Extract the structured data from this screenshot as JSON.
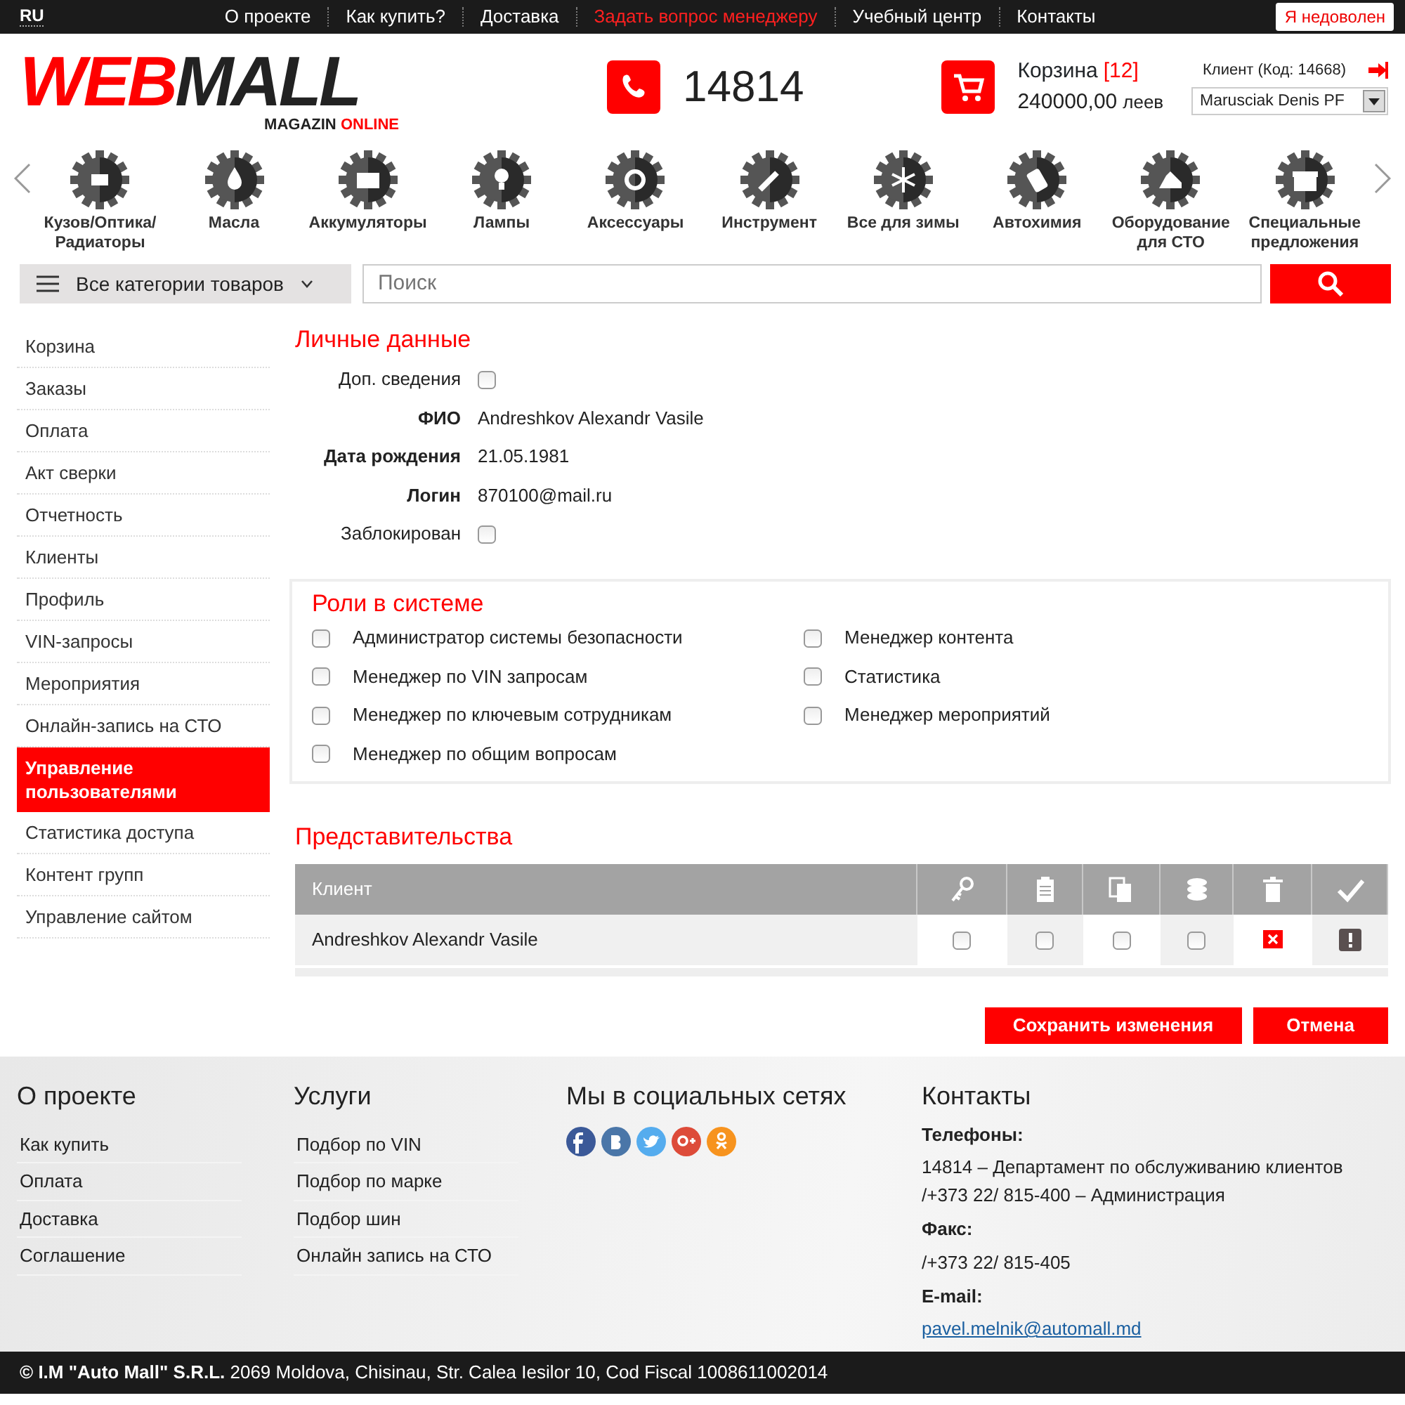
{
  "top_bar": {
    "language": "RU",
    "links": [
      {
        "label": "О проекте",
        "highlight": false
      },
      {
        "label": "Как купить?",
        "highlight": false
      },
      {
        "label": "Доставка",
        "highlight": false
      },
      {
        "label": "Задать вопрос менеджеру",
        "highlight": true
      },
      {
        "label": "Учебный центр",
        "highlight": false
      },
      {
        "label": "Контакты",
        "highlight": false
      }
    ],
    "complaint_button": "Я недоволен"
  },
  "header": {
    "logo": {
      "accent": "WEB",
      "rest": "MALL",
      "tagline": "MAGAZIN",
      "tagline_accent": "ONLINE"
    },
    "phone": "14814",
    "cart": {
      "label": "Корзина",
      "count": "[12]",
      "total": "240000,00",
      "currency": "леев"
    },
    "client": {
      "label": "Клиент (Код: 14668)",
      "account": "Marusciak Denis PF"
    }
  },
  "categories": [
    {
      "label": "Кузов/Оптика/ Радиаторы"
    },
    {
      "label": "Масла"
    },
    {
      "label": "Аккумуляторы"
    },
    {
      "label": "Лампы"
    },
    {
      "label": "Аксессуары"
    },
    {
      "label": "Инструмент"
    },
    {
      "label": "Все для зимы"
    },
    {
      "label": "Автохимия"
    },
    {
      "label": "Оборудование для СТО"
    },
    {
      "label": "Специальные предложения"
    }
  ],
  "search": {
    "categories_button": "Все категории товаров",
    "placeholder": "Поиск"
  },
  "sidebar": {
    "items": [
      {
        "label": "Корзина",
        "selected": false
      },
      {
        "label": "Заказы",
        "selected": false
      },
      {
        "label": "Оплата",
        "selected": false
      },
      {
        "label": "Акт сверки",
        "selected": false
      },
      {
        "label": "Отчетность",
        "selected": false
      },
      {
        "label": "Клиенты",
        "selected": false
      },
      {
        "label": "Профиль",
        "selected": false
      },
      {
        "label": "VIN-запросы",
        "selected": false
      },
      {
        "label": "Мероприятия",
        "selected": false
      },
      {
        "label": "Онлайн-запись на СТО",
        "selected": false
      },
      {
        "label": "Управление пользователями",
        "selected": true
      },
      {
        "label": "Статистика доступа",
        "selected": false
      },
      {
        "label": "Контент групп",
        "selected": false
      },
      {
        "label": "Управление сайтом",
        "selected": false
      }
    ]
  },
  "personal": {
    "title": "Личные данные",
    "fields": [
      {
        "kind": "checkbox",
        "label": "Доп. сведения",
        "checked": false
      },
      {
        "kind": "text",
        "label": "ФИО",
        "value": "Andreshkov Alexandr Vasile"
      },
      {
        "kind": "text",
        "label": "Дата рождения",
        "value": "21.05.1981"
      },
      {
        "kind": "text",
        "label": "Логин",
        "value": "870100@mail.ru"
      },
      {
        "kind": "checkbox",
        "label": "Заблокирован",
        "checked": false
      }
    ]
  },
  "roles": {
    "title": "Роли в системе",
    "columns": [
      [
        {
          "label": "Администратор системы безопасности",
          "checked": false
        },
        {
          "label": "Менеджер по VIN запросам",
          "checked": false
        },
        {
          "label": "Менеджер по ключевым сотрудникам",
          "checked": false
        },
        {
          "label": "Менеджер по общим вопросам",
          "checked": false
        }
      ],
      [
        {
          "label": "Менеджер контента",
          "checked": false
        },
        {
          "label": "Статистика",
          "checked": false
        },
        {
          "label": "Менеджер мероприятий",
          "checked": false
        }
      ]
    ]
  },
  "representations": {
    "title": "Представительства",
    "client_column": "Клиент",
    "rows": [
      {
        "client": "Andreshkov Alexandr Vasile",
        "cells": [
          {
            "kind": "checkbox",
            "checked": false
          },
          {
            "kind": "checkbox",
            "checked": false
          },
          {
            "kind": "checkbox",
            "checked": false
          },
          {
            "kind": "checkbox",
            "checked": false
          },
          {
            "kind": "delete"
          },
          {
            "kind": "warning"
          }
        ]
      }
    ]
  },
  "buttons": {
    "save": "Сохранить изменения",
    "cancel": "Отмена"
  },
  "footer": {
    "about": {
      "title": "О проекте",
      "links": [
        "Как купить",
        "Оплата",
        "Доставка",
        "Соглашение"
      ]
    },
    "services": {
      "title": "Услуги",
      "links": [
        "Подбор по VIN",
        "Подбор по марке",
        "Подбор шин",
        "Онлайн запись на СТО"
      ]
    },
    "social": {
      "title": "Мы в социальных сетях"
    },
    "contacts": {
      "title": "Контакты",
      "items": [
        {
          "kind": "label",
          "text": "Телефоны:"
        },
        {
          "kind": "text",
          "text": "14814 – Департамент по обслуживанию клиентов"
        },
        {
          "kind": "text",
          "text": "/+373 22/ 815-400 – Администрация"
        },
        {
          "kind": "label",
          "text": "Факс:"
        },
        {
          "kind": "text",
          "text": "/+373 22/ 815-405"
        },
        {
          "kind": "label",
          "text": "E-mail:"
        },
        {
          "kind": "link",
          "text": "pavel.melnik@automall.md"
        }
      ]
    }
  },
  "bottom_bar": "**© I.M \"Auto Mall\" S.R.L.** 2069 Moldova, Chisinau, Str. Calea Iesilor 10, Cod Fiscal 1008611002014"
}
